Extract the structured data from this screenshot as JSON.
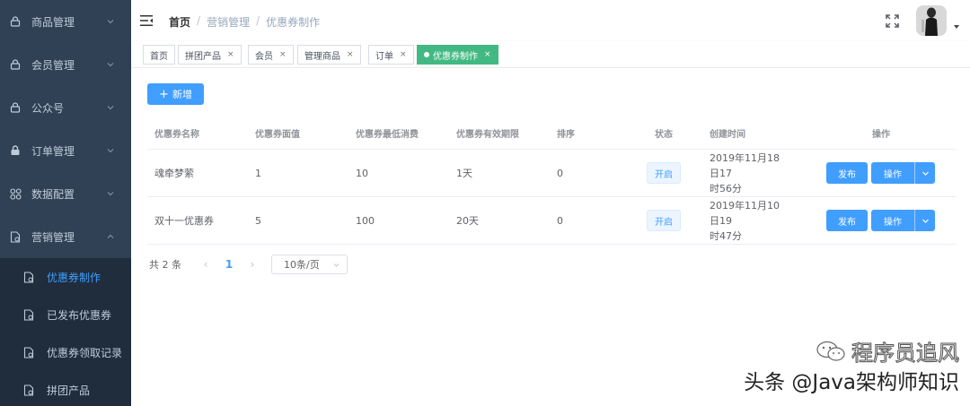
{
  "sidebar": {
    "items": [
      {
        "label": "商品管理",
        "icon": "lock-icon"
      },
      {
        "label": "会员管理",
        "icon": "lock-icon"
      },
      {
        "label": "公众号",
        "icon": "lock-icon"
      },
      {
        "label": "订单管理",
        "icon": "lock-icon"
      },
      {
        "label": "数据配置",
        "icon": "grid-icon"
      },
      {
        "label": "营销管理",
        "icon": "document-icon"
      }
    ],
    "sub_items": [
      {
        "label": "优惠券制作",
        "active": true
      },
      {
        "label": "已发布优惠券"
      },
      {
        "label": "优惠券领取记录"
      },
      {
        "label": "拼团产品"
      }
    ],
    "colors": {
      "background": "#304156",
      "submenu_bg": "#1f2d3d",
      "text": "#bfcbd9",
      "active": "#409eff"
    }
  },
  "header": {
    "breadcrumb": [
      "首页",
      "营销管理",
      "优惠券制作"
    ],
    "breadcrumb_separator": "/"
  },
  "tags": [
    {
      "label": "首页",
      "closable": false
    },
    {
      "label": "拼团产品",
      "closable": true
    },
    {
      "label": "会员",
      "closable": true
    },
    {
      "label": "管理商品",
      "closable": true
    },
    {
      "label": "订单",
      "closable": true
    },
    {
      "label": "优惠券制作",
      "closable": true,
      "active": true
    }
  ],
  "tag_close_symbol": "×",
  "toolbar": {
    "add_label": "新增",
    "add_symbol": "+"
  },
  "table": {
    "columns": [
      "优惠券名称",
      "优惠券面值",
      "优惠券最低消费",
      "优惠券有效期限",
      "排序",
      "状态",
      "创建时间",
      "操作"
    ],
    "rows": [
      {
        "name": "魂牵梦萦",
        "value": "1",
        "min_spend": "10",
        "validity": "1天",
        "sort": "0",
        "status": "开启",
        "created_line1": "2019年11月18日17",
        "created_line2": "时56分",
        "publish_label": "发布",
        "action_label": "操作"
      },
      {
        "name": "双十一优惠券",
        "value": "5",
        "min_spend": "100",
        "validity": "20天",
        "sort": "0",
        "status": "开启",
        "created_line1": "2019年11月10日19",
        "created_line2": "时47分",
        "publish_label": "发布",
        "action_label": "操作"
      }
    ]
  },
  "pagination": {
    "total_label": "共 2 条",
    "current_page": "1",
    "page_size": "10条/页"
  },
  "watermark": {
    "line1": "程序员追风",
    "line2": "头条 @Java架构师知识"
  },
  "colors": {
    "primary": "#409eff",
    "tag_active": "#42b983"
  }
}
